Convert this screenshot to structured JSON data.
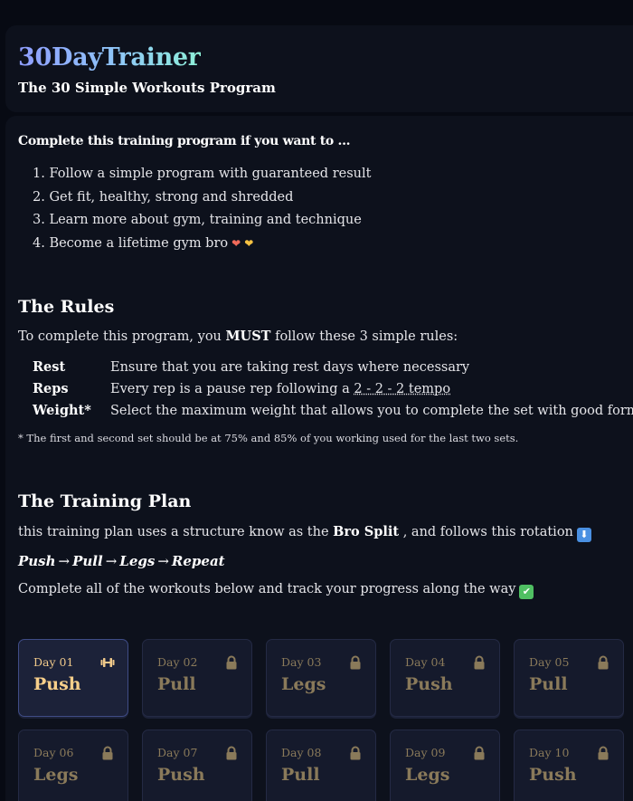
{
  "header": {
    "app_title": "30DayTrainer",
    "subtitle": "The 30 Simple Workouts Program"
  },
  "intro": {
    "heading": "Complete this training program if you want to ...",
    "goals": [
      "1. Follow a simple program with guaranteed result",
      "2. Get fit, healthy, strong and shredded",
      "3. Learn more about gym, training and technique",
      "4. Become a lifetime gym bro"
    ],
    "heart_icons": [
      "red-heart-icon",
      "yellow-heart-icon"
    ]
  },
  "rules": {
    "title": "The Rules",
    "intro_before": "To complete this program, you ",
    "intro_bold": "MUST",
    "intro_after": " follow these 3 simple rules:",
    "items": [
      {
        "name": "Rest",
        "text": "Ensure that you are taking rest days where necessary",
        "extra": ""
      },
      {
        "name": "Reps",
        "text": "Every rep is a pause rep following a ",
        "extra": "2 - 2 - 2 tempo"
      },
      {
        "name": "Weight*",
        "text": "Select the maximum weight that allows you to complete the set with good form",
        "extra": ""
      }
    ],
    "footnote": "* The first and second set should be at 75% and 85% of you working used for the last two sets."
  },
  "plan": {
    "title": "The Training Plan",
    "intro_before": "this training plan uses a structure know as the ",
    "intro_bold": "Bro Split",
    "intro_after": " , and follows this rotation",
    "intro_icon": "down-arrow-icon",
    "rotation": [
      "Push",
      "Pull",
      "Legs",
      "Repeat"
    ],
    "rotation_separator": "→",
    "complete_text": "Complete all of the workouts below and track your progress along the way",
    "complete_icon": "check-mark-icon"
  },
  "days": [
    {
      "label": "Day 01",
      "name": "Push",
      "icon": "dumbbell-icon",
      "active": true
    },
    {
      "label": "Day 02",
      "name": "Pull",
      "icon": "lock-icon",
      "active": false
    },
    {
      "label": "Day 03",
      "name": "Legs",
      "icon": "lock-icon",
      "active": false
    },
    {
      "label": "Day 04",
      "name": "Push",
      "icon": "lock-icon",
      "active": false
    },
    {
      "label": "Day 05",
      "name": "Pull",
      "icon": "lock-icon",
      "active": false
    },
    {
      "label": "Day 06",
      "name": "Legs",
      "icon": "lock-icon",
      "active": false
    },
    {
      "label": "Day 07",
      "name": "Push",
      "icon": "lock-icon",
      "active": false
    },
    {
      "label": "Day 08",
      "name": "Pull",
      "icon": "lock-icon",
      "active": false
    },
    {
      "label": "Day 09",
      "name": "Legs",
      "icon": "lock-icon",
      "active": false
    },
    {
      "label": "Day 10",
      "name": "Push",
      "icon": "lock-icon",
      "active": false
    }
  ],
  "colors": {
    "background": "#070a13",
    "card": "#0d111c",
    "tile": "#151a2c",
    "active_tile_border": "#3f4c86",
    "active_day_text": "#f7cf8a",
    "locked_day_text": "#8a7a5a",
    "title_gradient_start": "#8f9dff",
    "title_gradient_end": "#8ef0d8"
  }
}
